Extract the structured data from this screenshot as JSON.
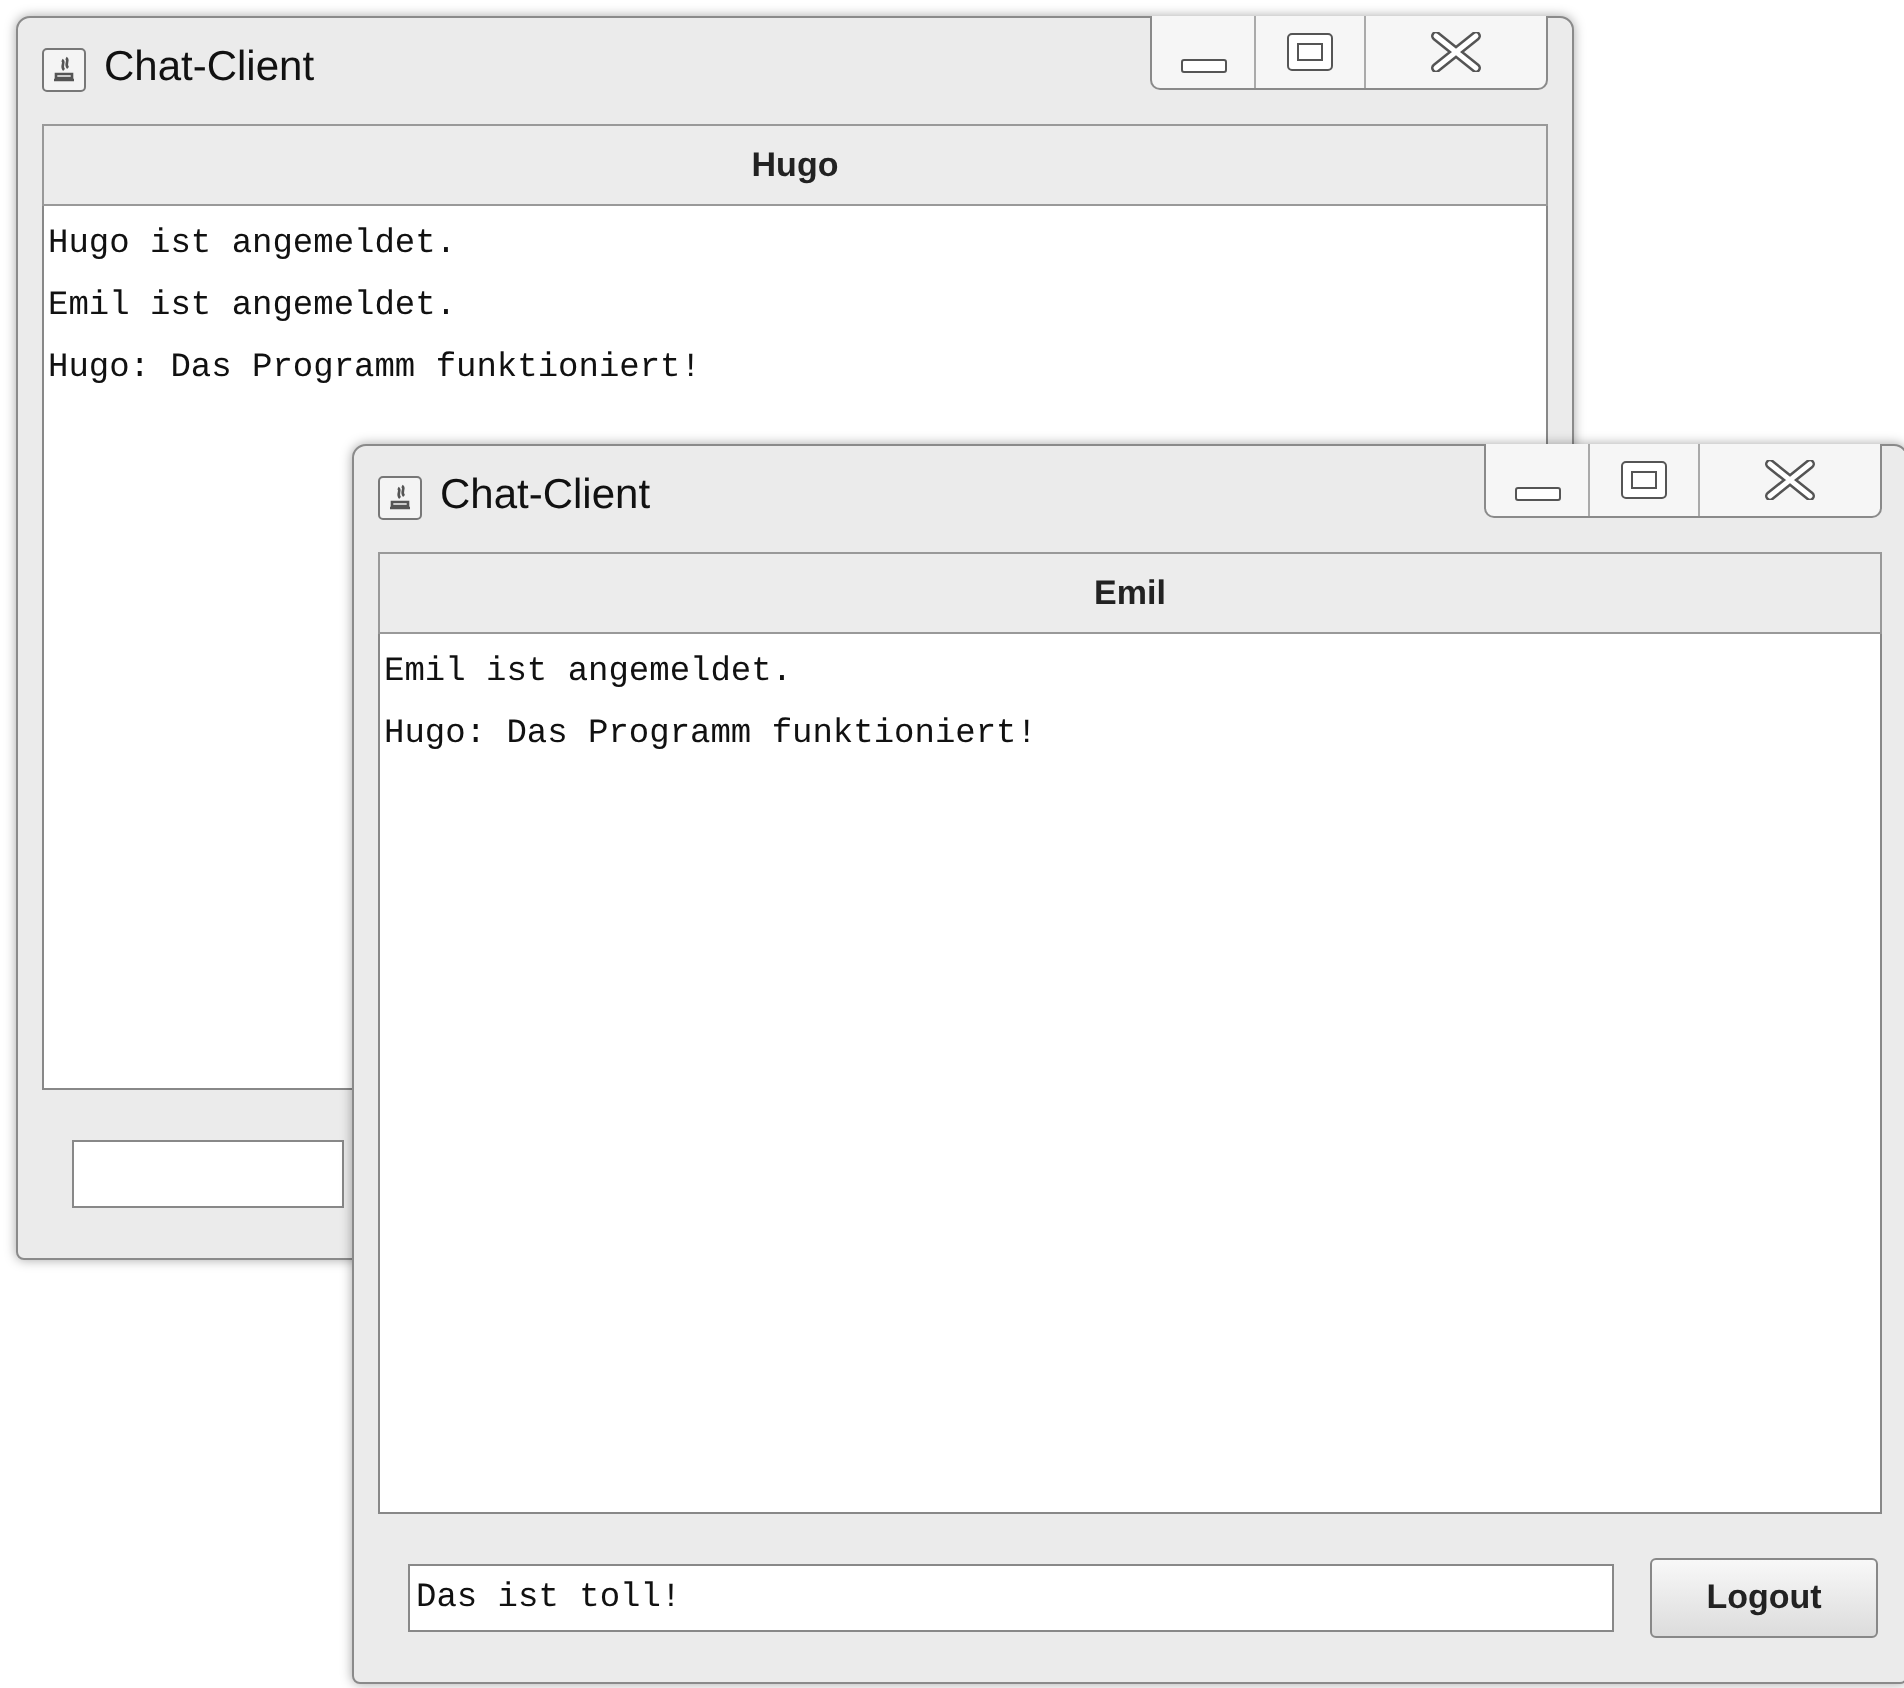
{
  "windows": [
    {
      "title": "Chat-Client",
      "header": "Hugo",
      "messages": [
        "Hugo ist angemeldet.",
        "Emil ist angemeldet.",
        "Hugo: Das Programm funktioniert!"
      ]
    },
    {
      "title": "Chat-Client",
      "header": "Emil",
      "messages": [
        "Emil ist angemeldet.",
        "Hugo: Das Programm funktioniert!"
      ],
      "input": {
        "value": "Das ist toll!"
      },
      "button": "Logout"
    }
  ]
}
